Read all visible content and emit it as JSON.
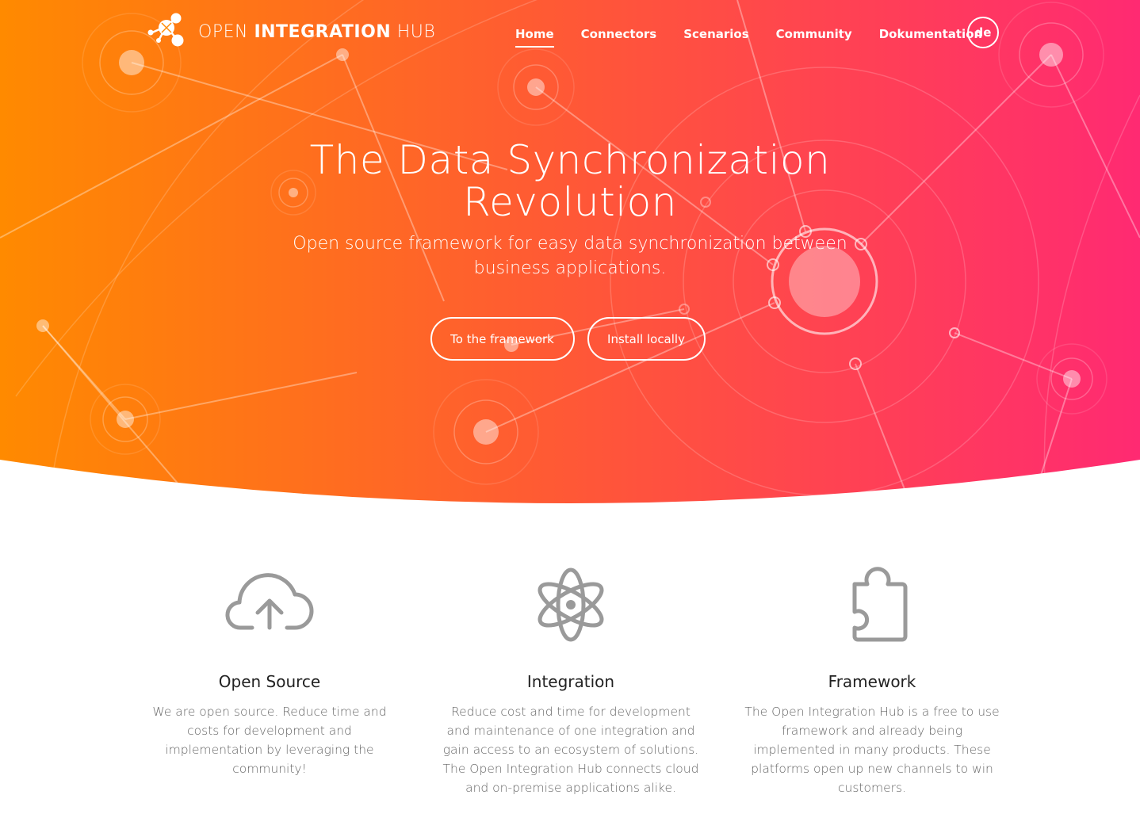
{
  "brand": {
    "name_light": "OPEN ",
    "name_bold": "INTEGRATION",
    "name_light_2": " HUB",
    "logo_icon": "network-molecule-logo-icon"
  },
  "nav": {
    "items": [
      {
        "label": "Home",
        "active": true
      },
      {
        "label": "Connectors",
        "active": false
      },
      {
        "label": "Scenarios",
        "active": false
      },
      {
        "label": "Community",
        "active": false
      },
      {
        "label": "Dokumentation",
        "active": false
      }
    ],
    "language": "de"
  },
  "hero": {
    "title_line1": "The Data Synchronization",
    "title_line2": "Revolution",
    "subtitle": "Open source framework for easy data synchronization between business applications.",
    "buttons": {
      "framework": "To the framework",
      "install": "Install locally"
    },
    "gradient": {
      "start": "#ff8a00",
      "mid": "#ff5a3c",
      "end": "#ff2a6d"
    }
  },
  "features": [
    {
      "icon": "cloud-upload-icon",
      "title": "Open Source",
      "text": "We are open source. Reduce time and costs for development and implementation by leveraging the community!"
    },
    {
      "icon": "atom-icon",
      "title": "Integration",
      "text": "Reduce cost and time for development and maintenance of one integration and gain access to an ecosystem of solutions. The Open Integration Hub connects cloud and on-premise applications alike."
    },
    {
      "icon": "puzzle-piece-icon",
      "title": "Framework",
      "text": "The Open Integration Hub is a free to use framework and already being implemented in many products. These platforms open up new channels to win customers."
    }
  ],
  "colors": {
    "icon_gray": "#9a9a9a",
    "heading": "#222222",
    "body_text": "#666666"
  }
}
